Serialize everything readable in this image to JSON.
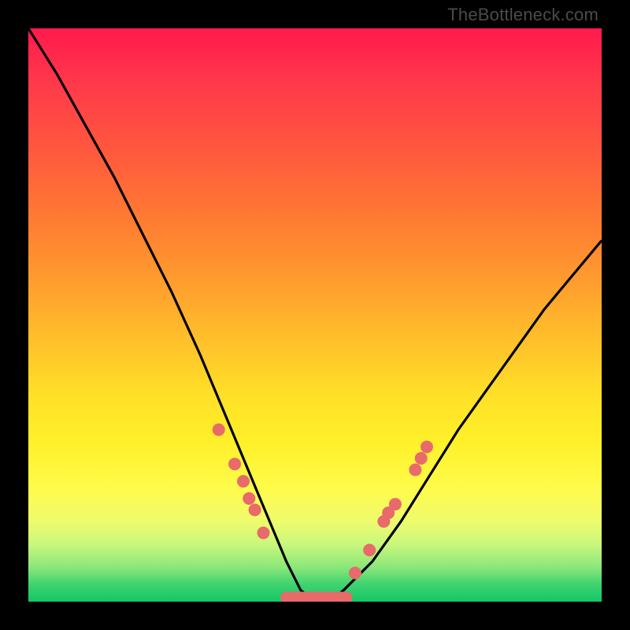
{
  "watermark": "TheBottleneck.com",
  "chart_data": {
    "type": "line",
    "title": "",
    "xlabel": "",
    "ylabel": "",
    "xlim": [
      0,
      1
    ],
    "ylim": [
      0,
      1
    ],
    "annotations": [],
    "series": [
      {
        "name": "bottleneck-curve",
        "x": [
          0.0,
          0.05,
          0.1,
          0.15,
          0.2,
          0.25,
          0.3,
          0.35,
          0.4,
          0.45,
          0.475,
          0.5,
          0.525,
          0.55,
          0.6,
          0.65,
          0.7,
          0.75,
          0.8,
          0.85,
          0.9,
          0.95,
          1.0
        ],
        "y_norm": [
          1.0,
          0.92,
          0.83,
          0.74,
          0.64,
          0.54,
          0.43,
          0.31,
          0.19,
          0.07,
          0.02,
          0.0,
          0.0,
          0.02,
          0.07,
          0.14,
          0.22,
          0.3,
          0.37,
          0.44,
          0.51,
          0.57,
          0.63
        ]
      }
    ],
    "markers": {
      "name": "highlight-dots",
      "color": "#e86a6a",
      "radius_px": 8,
      "points_norm": [
        {
          "x": 0.332,
          "y": 0.3
        },
        {
          "x": 0.36,
          "y": 0.24
        },
        {
          "x": 0.375,
          "y": 0.21
        },
        {
          "x": 0.385,
          "y": 0.18
        },
        {
          "x": 0.395,
          "y": 0.16
        },
        {
          "x": 0.41,
          "y": 0.12
        },
        {
          "x": 0.57,
          "y": 0.05
        },
        {
          "x": 0.595,
          "y": 0.09
        },
        {
          "x": 0.62,
          "y": 0.14
        },
        {
          "x": 0.628,
          "y": 0.155
        },
        {
          "x": 0.64,
          "y": 0.17
        },
        {
          "x": 0.675,
          "y": 0.23
        },
        {
          "x": 0.685,
          "y": 0.25
        },
        {
          "x": 0.695,
          "y": 0.27
        }
      ]
    },
    "trough": {
      "name": "flat-bottom-band",
      "color": "#e86a6a",
      "x_start_norm": 0.45,
      "x_end_norm": 0.555,
      "y_norm": 0.007,
      "thickness_px": 15
    }
  },
  "colors": {
    "frame": "#000000",
    "curve": "#000000",
    "marker": "#e86a6a",
    "watermark": "#4b4b4b"
  }
}
